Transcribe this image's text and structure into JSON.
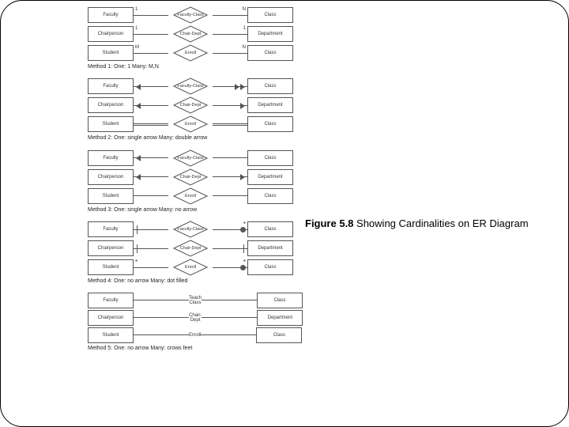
{
  "figure": {
    "number": "Figure 5.8",
    "title": " Showing Cardinalities on ER Diagram"
  },
  "entities": {
    "faculty": "Faculty",
    "class": "Class",
    "chairperson": "Chairperson",
    "department": "Department",
    "student": "Student"
  },
  "relationships": {
    "faculty_class": "Faculty-Class",
    "chair_dept": "Chair-Dept",
    "enroll": "Enroll",
    "teach_class": "Teach Class"
  },
  "methods": {
    "m1": "Method 1: One: 1\nMany: M,N",
    "m2": "Method 2: One: single arrow\nMany: double arrow",
    "m3": "Method 3: One: single arrow\nMany: no arrow",
    "m4": "Method 4: One: no arrow\nMany: dot filled",
    "m5": "Method 5: One: no arrow\nMany: crows feet"
  },
  "cards": {
    "one": "1",
    "M": "M",
    "N": "N",
    "star": "*"
  }
}
